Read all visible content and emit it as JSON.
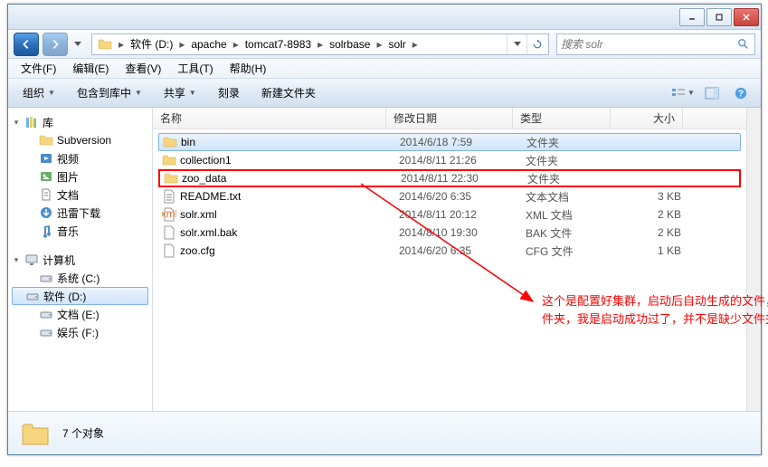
{
  "titlebar": {},
  "breadcrumb": {
    "items": [
      "软件 (D:)",
      "apache",
      "tomcat7-8983",
      "solrbase",
      "solr"
    ]
  },
  "search": {
    "placeholder": "搜索 solr"
  },
  "menubar": {
    "file": "文件(F)",
    "edit": "编辑(E)",
    "view": "查看(V)",
    "tools": "工具(T)",
    "help": "帮助(H)"
  },
  "toolbar": {
    "organize": "组织",
    "include": "包含到库中",
    "share": "共享",
    "burn": "刻录",
    "newfolder": "新建文件夹"
  },
  "sidebar": {
    "library": "库",
    "library_items": [
      "Subversion",
      "视频",
      "图片",
      "文档",
      "迅雷下载",
      "音乐"
    ],
    "computer": "计算机",
    "computer_items": [
      "系统 (C:)",
      "软件 (D:)",
      "文档 (E:)",
      "娱乐 (F:)"
    ]
  },
  "columns": {
    "name": "名称",
    "date": "修改日期",
    "type": "类型",
    "size": "大小"
  },
  "files": [
    {
      "name": "bin",
      "date": "2014/6/18 7:59",
      "type": "文件夹",
      "size": "",
      "icon": "folder"
    },
    {
      "name": "collection1",
      "date": "2014/8/11 21:26",
      "type": "文件夹",
      "size": "",
      "icon": "folder"
    },
    {
      "name": "zoo_data",
      "date": "2014/8/11 22:30",
      "type": "文件夹",
      "size": "",
      "icon": "folder",
      "highlighted": true
    },
    {
      "name": "README.txt",
      "date": "2014/6/20 6:35",
      "type": "文本文档",
      "size": "3 KB",
      "icon": "txt"
    },
    {
      "name": "solr.xml",
      "date": "2014/8/11 20:12",
      "type": "XML 文档",
      "size": "2 KB",
      "icon": "xml"
    },
    {
      "name": "solr.xml.bak",
      "date": "2014/8/10 19:30",
      "type": "BAK 文件",
      "size": "2 KB",
      "icon": "file"
    },
    {
      "name": "zoo.cfg",
      "date": "2014/6/20 6:35",
      "type": "CFG 文件",
      "size": "1 KB",
      "icon": "file"
    }
  ],
  "annotation": "这个是配置好集群，启动后自动生成的文件，新复制的不带这个文件夹，我是启动成功过了，并不是缺少文件夹，暂时不用管",
  "statusbar": {
    "count": "7 个对象"
  }
}
